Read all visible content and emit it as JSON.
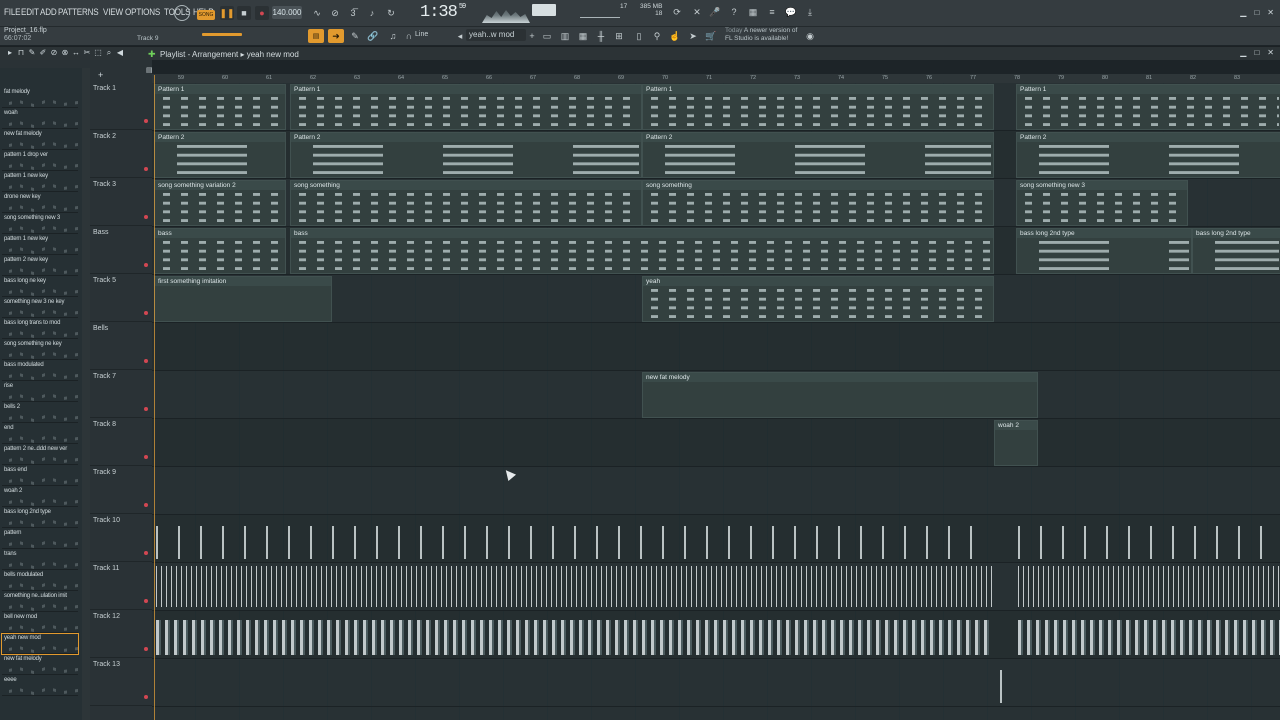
{
  "menus": [
    "FILE",
    "EDIT",
    "ADD",
    "PATTERNS",
    "VIEW",
    "OPTIONS",
    "TOOLS",
    "HELP"
  ],
  "transport": {
    "mode": "SONG",
    "tempo": "140.000",
    "time": "1:38",
    "time_sub": "59",
    "cpu_ram": "385 MB",
    "cpu_val": "18",
    "voices": "17"
  },
  "project": {
    "name": "Project_16.flp",
    "time": "66:07:02",
    "track_hint": "Track 9"
  },
  "toolbar": {
    "snap_mode": "Line",
    "pattern_selector": "yeah..w mod"
  },
  "news": {
    "label": "Today",
    "message": "A newer version of",
    "message2": "FL Studio is available!"
  },
  "playlist": {
    "title": "Playlist - Arrangement",
    "pattern": "yeah new mod"
  },
  "ruler_ticks": [
    "59",
    "60",
    "61",
    "62",
    "63",
    "64",
    "65",
    "66",
    "67",
    "68",
    "69",
    "70",
    "71",
    "72",
    "73",
    "74",
    "75",
    "76",
    "77",
    "78",
    "79",
    "80",
    "81",
    "82",
    "83"
  ],
  "browser_patterns": [
    "fat melody",
    "woah",
    "new fat melody",
    "pattern 1 drop ver",
    "pattern 1 new key",
    "drone new key",
    "song something new 3",
    "pattern 1 new key",
    "pattern 2 new key",
    "bass long ne key",
    "something new 3 ne key",
    "bass long trans to mod",
    "song something ne key",
    "bass modulated",
    "rise",
    "bells 2",
    "end",
    "pattern 2 ne..ddd new ver",
    "bass end",
    "woah 2",
    "bass long 2nd type",
    "pattern",
    "trans",
    "bells modulated",
    "something ne..ulation imit",
    "bell new mod",
    "yeah new mod",
    "new fat melody",
    "eeee"
  ],
  "tracks": [
    {
      "name": "Track 1",
      "clips": [
        {
          "label": "Pattern 1"
        },
        {
          "label": "Pattern 1"
        },
        {
          "label": "Pattern 1"
        },
        {
          "label": "Pattern 1"
        }
      ]
    },
    {
      "name": "Track 2",
      "clips": [
        {
          "label": "Pattern 2"
        },
        {
          "label": "Pattern 2"
        },
        {
          "label": "Pattern 2"
        },
        {
          "label": "Pattern 2"
        }
      ]
    },
    {
      "name": "Track 3",
      "clips": [
        {
          "label": "song something variation 2"
        },
        {
          "label": "song something"
        },
        {
          "label": "song something"
        },
        {
          "label": "song something new 3"
        }
      ]
    },
    {
      "name": "Bass",
      "clips": [
        {
          "label": "bass"
        },
        {
          "label": "bass"
        },
        {
          "label": "bass long 2nd type"
        },
        {
          "label": "bass long 2nd type"
        }
      ]
    },
    {
      "name": "Track 5",
      "clips": [
        {
          "label": "first something imitation"
        },
        {
          "label": "yeah"
        }
      ]
    },
    {
      "name": "Bells",
      "clips": []
    },
    {
      "name": "Track 7",
      "clips": [
        {
          "label": "new fat melody"
        }
      ]
    },
    {
      "name": "Track 8",
      "clips": [
        {
          "label": "woah 2"
        }
      ]
    },
    {
      "name": "Track 9",
      "clips": []
    },
    {
      "name": "Track 10",
      "clips": []
    },
    {
      "name": "Track 11",
      "clips": []
    },
    {
      "name": "Track 12",
      "clips": []
    },
    {
      "name": "Track 13",
      "clips": []
    }
  ],
  "colors": {
    "accent": "#e29a2e",
    "clip": "#33403f",
    "record_dot": "#d24752"
  }
}
